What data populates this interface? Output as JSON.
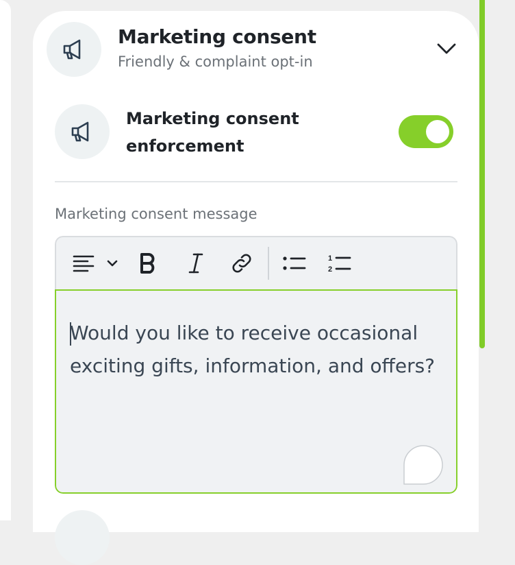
{
  "header": {
    "title": "Marketing consent",
    "subtitle": "Friendly & complaint opt-in",
    "icon": "megaphone-icon",
    "expand_icon": "chevron-down-icon"
  },
  "setting": {
    "label": "Marketing consent enforcement",
    "icon": "megaphone-icon",
    "enabled": true
  },
  "message_field": {
    "label": "Marketing consent message",
    "value": "Would you like to receive occasional exciting gifts, information, and offers?"
  },
  "toolbar": {
    "buttons": [
      "align-left-icon",
      "chevron-down-icon",
      "bold-icon",
      "italic-icon",
      "link-icon",
      "bullet-list-icon",
      "numbered-list-icon"
    ]
  },
  "colors": {
    "accent": "#86cf2a",
    "scrollbar": "#80cc28",
    "text": "#1f2328",
    "muted": "#6b7177",
    "editor_bg": "#f0f2f4"
  }
}
